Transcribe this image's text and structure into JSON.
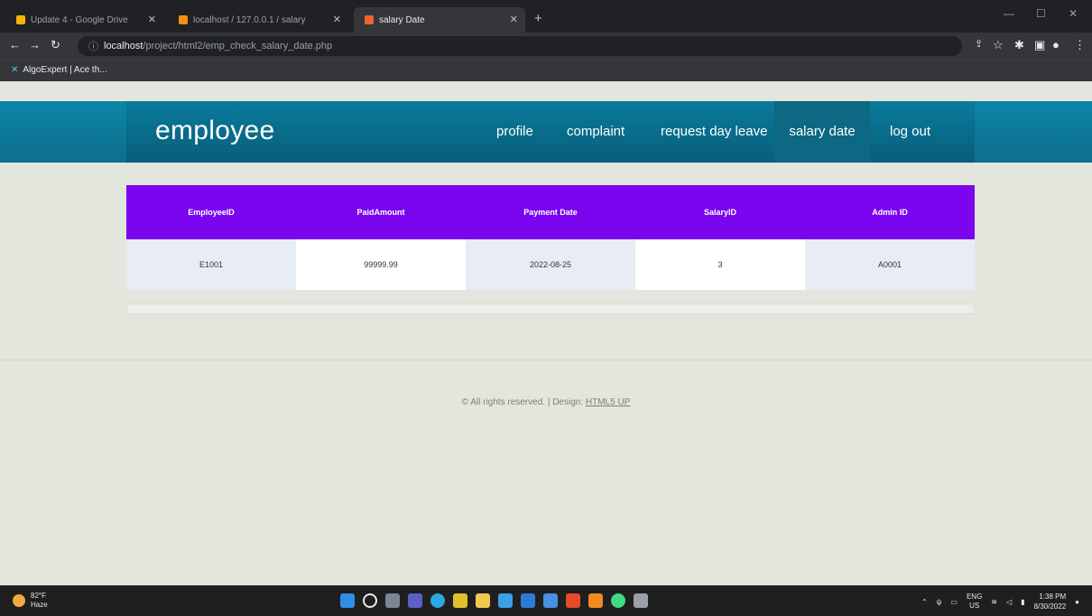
{
  "browser": {
    "tabs": [
      {
        "label": "Update 4 - Google Drive",
        "favicon": "drive-icon",
        "color": "#f4b400",
        "active": false
      },
      {
        "label": "localhost / 127.0.0.1 / salary",
        "favicon": "phpmyadmin-icon",
        "color": "#f29111",
        "active": false
      },
      {
        "label": "salary Date",
        "favicon": "html-icon",
        "color": "#f06529",
        "active": true
      }
    ],
    "new_tab_symbol": "+",
    "url_host": "localhost",
    "url_path": "/project/html2/emp_check_salary_date.php",
    "bookmark_label": "AlgoExpert | Ace th..."
  },
  "page": {
    "brand": "employee",
    "nav": [
      {
        "label": "profile",
        "active": false
      },
      {
        "label": "complaint",
        "active": false
      },
      {
        "label": "request day leave",
        "active": false
      },
      {
        "label": "salary date",
        "active": true
      },
      {
        "label": "log out",
        "active": false
      }
    ],
    "table": {
      "columns": [
        "EmployeeID",
        "PaidAmount",
        "Payment Date",
        "SalaryID",
        "Admin ID"
      ],
      "rows": [
        [
          "E1001",
          "99999.99",
          "2022-08-25",
          "3",
          "A0001"
        ]
      ]
    },
    "footer": {
      "text": "© All rights reserved. | Design: ",
      "link": "HTML5 UP"
    }
  },
  "taskbar": {
    "weather_temp": "82°F",
    "weather_desc": "Haze",
    "lang_top": "ENG",
    "lang_bottom": "US",
    "time": "1:38 PM",
    "date": "8/30/2022"
  },
  "colors": {
    "navbar": "#0a7a9b",
    "table_header": "#7a05ee",
    "page_bg": "#e3e6dd"
  }
}
